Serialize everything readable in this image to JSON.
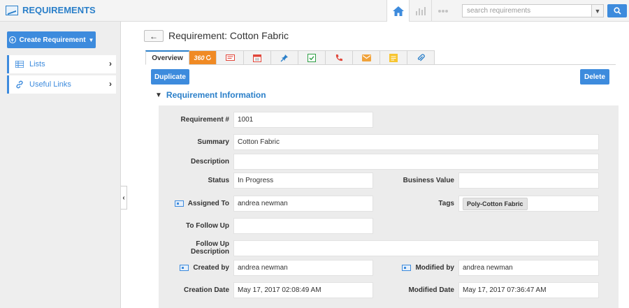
{
  "app": {
    "title": "REQUIREMENTS"
  },
  "search": {
    "placeholder": "search requirements"
  },
  "sidebar": {
    "create_label": "Create Requirement",
    "items": [
      {
        "label": "Lists"
      },
      {
        "label": "Useful Links"
      }
    ]
  },
  "page": {
    "title": "Requirement: Cotton Fabric"
  },
  "tabs": {
    "overview": "Overview",
    "t360": "360"
  },
  "actions": {
    "duplicate": "Duplicate",
    "delete": "Delete"
  },
  "section": {
    "title": "Requirement Information"
  },
  "fields": {
    "requirement_no": {
      "label": "Requirement #",
      "value": "1001"
    },
    "summary": {
      "label": "Summary",
      "value": "Cotton Fabric"
    },
    "description": {
      "label": "Description",
      "value": ""
    },
    "status": {
      "label": "Status",
      "value": "In Progress"
    },
    "business_value": {
      "label": "Business Value",
      "value": ""
    },
    "assigned_to": {
      "label": "Assigned To",
      "value": "andrea newman"
    },
    "tags": {
      "label": "Tags",
      "value": "Poly-Cotton Fabric"
    },
    "to_follow_up": {
      "label": "To Follow Up",
      "value": ""
    },
    "follow_up_description": {
      "label": "Follow Up Description",
      "value": ""
    },
    "created_by": {
      "label": "Created by",
      "value": "andrea newman"
    },
    "modified_by": {
      "label": "Modified by",
      "value": "andrea newman"
    },
    "creation_date": {
      "label": "Creation Date",
      "value": "May 17, 2017 02:08:49 AM"
    },
    "modified_date": {
      "label": "Modified Date",
      "value": "May 17, 2017 07:36:47 AM"
    }
  },
  "colors": {
    "accent": "#3d8bdd",
    "brand": "#2a7fc9",
    "tab_360": "#f08a24"
  }
}
